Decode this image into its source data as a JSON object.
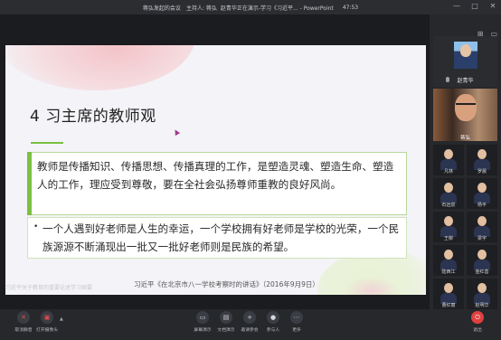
{
  "titlebar": {
    "meeting_name": "蒋弘发起的会议",
    "host": "主持人: 蒋弘",
    "presenting": "赵青华正在演示-学习《习近平... - PowerPoint",
    "timer": "47:53",
    "controls": [
      "—",
      "□",
      "✕"
    ]
  },
  "slide": {
    "title": "4 习主席的教师观",
    "paragraph1": "教师是传播知识、传播思想、传播真理的工作，是塑造灵魂、塑造生命、塑造人的工作，理应受到尊敬，要在全社会弘扬尊师重教的良好风尚。",
    "bullet": "•",
    "paragraph2": "一个人遇到好老师是人生的幸运，一个学校拥有好老师是学校的光荣，一个民族源源不断涌现出一批又一批好老师则是民族的希望。",
    "caption": "习近平《在北京市八一学校考察时的讲话》（2016年9月9日）",
    "watermark": "习近平关于教育的重要论述学习纲要"
  },
  "participants": {
    "presenter": {
      "name": "赵青华"
    },
    "live": {
      "name": "蒋弘"
    },
    "grid": [
      {
        "name": "凡林"
      },
      {
        "name": "罗晨"
      },
      {
        "name": "石远泉"
      },
      {
        "name": "杨平"
      },
      {
        "name": "王柳"
      },
      {
        "name": "梁宇"
      },
      {
        "name": "陆西江"
      },
      {
        "name": "金红善"
      },
      {
        "name": "曹红丽"
      },
      {
        "name": "赵明华"
      }
    ]
  },
  "toolbar": {
    "mute": "取消静音",
    "camera": "打开摄像头",
    "screen_share": "屏幕演示",
    "doc_share": "文档演示",
    "invite": "邀请参会",
    "participants": "参与人",
    "more": "更多",
    "end": "退出"
  },
  "colors": {
    "accent_green": "#7ac142",
    "end_red": "#e0403f"
  }
}
